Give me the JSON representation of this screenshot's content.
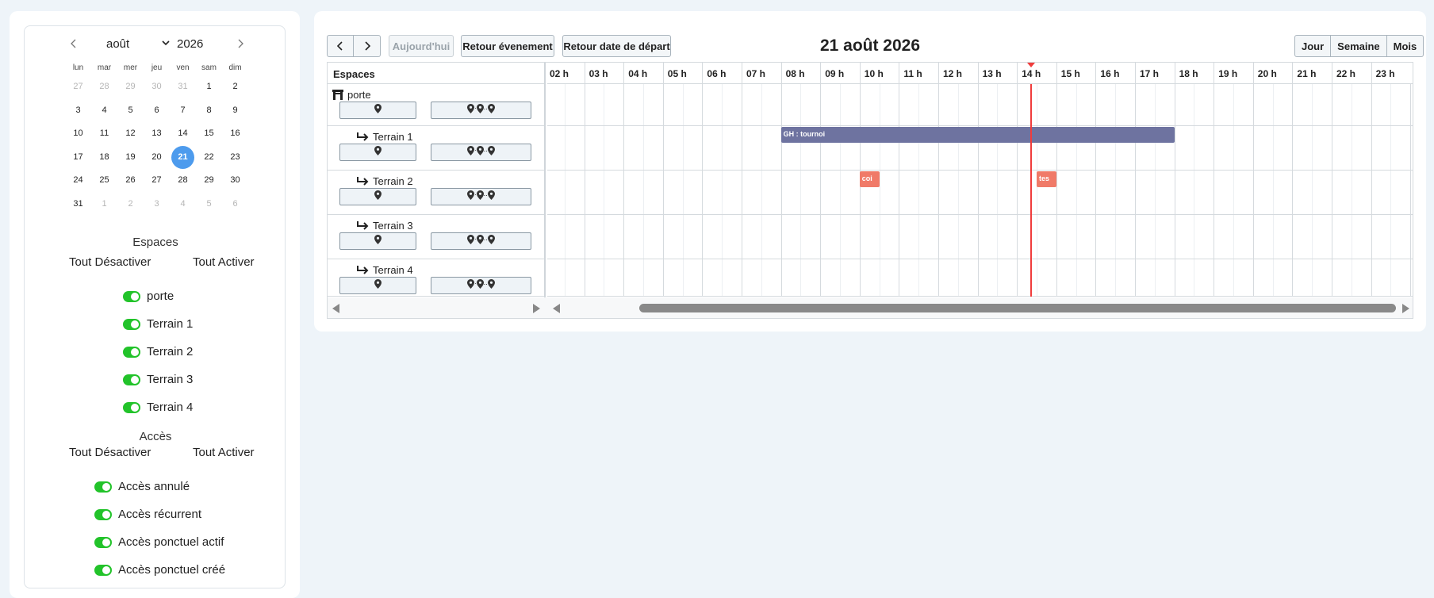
{
  "sidebar": {
    "calendar": {
      "month": "août",
      "year": "2026",
      "weekdays": [
        "lun",
        "mar",
        "mer",
        "jeu",
        "ven",
        "sam",
        "dim"
      ],
      "weeks": [
        [
          {
            "d": "27",
            "muted": true
          },
          {
            "d": "28",
            "muted": true
          },
          {
            "d": "29",
            "muted": true
          },
          {
            "d": "30",
            "muted": true
          },
          {
            "d": "31",
            "muted": true
          },
          {
            "d": "1"
          },
          {
            "d": "2"
          }
        ],
        [
          {
            "d": "3"
          },
          {
            "d": "4"
          },
          {
            "d": "5"
          },
          {
            "d": "6"
          },
          {
            "d": "7"
          },
          {
            "d": "8"
          },
          {
            "d": "9"
          }
        ],
        [
          {
            "d": "10"
          },
          {
            "d": "11"
          },
          {
            "d": "12"
          },
          {
            "d": "13"
          },
          {
            "d": "14"
          },
          {
            "d": "15"
          },
          {
            "d": "16"
          }
        ],
        [
          {
            "d": "17"
          },
          {
            "d": "18"
          },
          {
            "d": "19"
          },
          {
            "d": "20"
          },
          {
            "d": "21",
            "selected": true
          },
          {
            "d": "22"
          },
          {
            "d": "23"
          }
        ],
        [
          {
            "d": "24"
          },
          {
            "d": "25"
          },
          {
            "d": "26"
          },
          {
            "d": "27"
          },
          {
            "d": "28"
          },
          {
            "d": "29"
          },
          {
            "d": "30"
          }
        ],
        [
          {
            "d": "31"
          },
          {
            "d": "1",
            "muted": true
          },
          {
            "d": "2",
            "muted": true
          },
          {
            "d": "3",
            "muted": true
          },
          {
            "d": "4",
            "muted": true
          },
          {
            "d": "5",
            "muted": true
          },
          {
            "d": "6",
            "muted": true
          }
        ]
      ]
    },
    "spaces_title": "Espaces",
    "spaces_disable_all": "Tout Désactiver",
    "spaces_enable_all": "Tout Activer",
    "spaces": [
      "porte",
      "Terrain 1",
      "Terrain 2",
      "Terrain 3",
      "Terrain 4"
    ],
    "access_title": "Accès",
    "access_disable_all": "Tout Désactiver",
    "access_enable_all": "Tout Activer",
    "access": [
      "Accès annulé",
      "Accès récurrent",
      "Accès ponctuel actif",
      "Accès ponctuel créé"
    ]
  },
  "toolbar": {
    "today": "Aujourd'hui",
    "back_event": "Retour évenement",
    "back_start": "Retour date de départ",
    "title": "21 août 2026",
    "view_day": "Jour",
    "view_week": "Semaine",
    "view_month": "Mois"
  },
  "timeline": {
    "resources_header": "Espaces",
    "hours": [
      "02 h",
      "03 h",
      "04 h",
      "05 h",
      "06 h",
      "07 h",
      "08 h",
      "09 h",
      "10 h",
      "11 h",
      "12 h",
      "13 h",
      "14 h",
      "15 h",
      "16 h",
      "17 h",
      "18 h",
      "19 h",
      "20 h",
      "21 h",
      "22 h",
      "23 h"
    ],
    "rows": [
      {
        "name": "porte",
        "icon": "gate-icon"
      },
      {
        "name": "Terrain 1",
        "icon": "sub-arrow-icon"
      },
      {
        "name": "Terrain 2",
        "icon": "sub-arrow-icon"
      },
      {
        "name": "Terrain 3",
        "icon": "sub-arrow-icon"
      },
      {
        "name": "Terrain 4",
        "icon": "sub-arrow-icon"
      }
    ],
    "events": [
      {
        "row": 1,
        "start": 8.0,
        "end": 18.0,
        "label": "GH : tournoi",
        "color": "#6e73a0"
      },
      {
        "row": 2,
        "start": 10.0,
        "end": 10.5,
        "label": "coi",
        "color": "#f07a68"
      },
      {
        "row": 2,
        "start": 14.5,
        "end": 15.0,
        "label": "tes",
        "color": "#f07a68"
      }
    ],
    "now_hour": 14.33
  },
  "colors": {
    "accent": "#4d9bed",
    "toggle_on": "#22c32a",
    "now_line": "#f03c3c"
  }
}
